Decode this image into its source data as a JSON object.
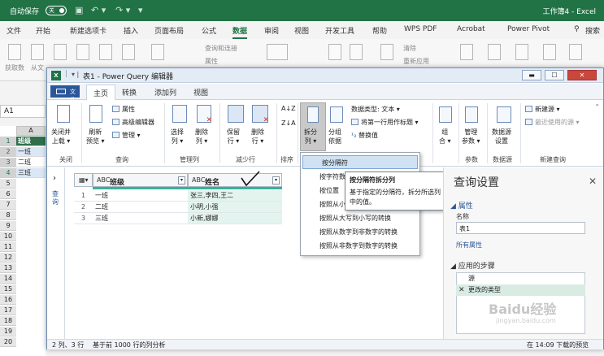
{
  "excel": {
    "autosave_label": "自动保存",
    "toggle_state": "关",
    "workbook_title": "工作簿4 - Excel",
    "tabs": [
      "文件",
      "开始",
      "新建选项卡",
      "插入",
      "页面布局",
      "公式",
      "数据",
      "审阅",
      "视图",
      "开发工具",
      "帮助",
      "WPS PDF",
      "Acrobat",
      "Power Pivot"
    ],
    "active_tab": "数据",
    "search_label": "搜索",
    "ribbon_visible": [
      "获取数",
      "从文",
      "查询和连接",
      "属性",
      "清除",
      "重新应用"
    ],
    "name_box": "A1",
    "col_header": "A",
    "rows": [
      "1",
      "2",
      "3",
      "4",
      "5",
      "6",
      "7",
      "8",
      "9",
      "10",
      "11",
      "12",
      "13",
      "14",
      "15",
      "16",
      "17",
      "18",
      "19",
      "20"
    ],
    "cells": [
      "班级",
      "一班",
      "二班",
      "三班"
    ]
  },
  "pq": {
    "title": "表1 - Power Query 编辑器",
    "file_tab": "文件",
    "tabs": [
      "主页",
      "转换",
      "添加列",
      "视图"
    ],
    "active_tab": "主页",
    "ribbon": {
      "close_load": "关闭并\n上载 ▾",
      "refresh_preview": "刷新\n预览 ▾",
      "properties": "属性",
      "advanced_editor": "高级编辑器",
      "manage": "管理 ▾",
      "choose_cols": "选择\n列 ▾",
      "remove_cols": "删除\n列 ▾",
      "keep_rows": "保留\n行 ▾",
      "remove_rows": "删除\n行 ▾",
      "split_col": "拆分\n列 ▾",
      "group_by": "分组\n依据",
      "data_type": "数据类型: 文本 ▾",
      "first_row_header": "将第一行用作标题 ▾",
      "replace_values": "替换值",
      "combine": "组\n合 ▾",
      "manage_params": "管理\n参数 ▾",
      "data_source_settings": "数据源\n设置",
      "new_source": "新建源 ▾",
      "recent_sources": "最近使用的源 ▾",
      "groups": [
        "关闭",
        "查询",
        "管理列",
        "减少行",
        "排序",
        "参数",
        "数据源",
        "新建查询"
      ]
    },
    "query_pane_label": "查询",
    "columns": [
      {
        "type": "ABC",
        "name": "班级"
      },
      {
        "type": "ABC",
        "name": "姓名"
      }
    ],
    "rows": [
      {
        "n": "1",
        "c1": "一班",
        "c2": "张三,李四,王二"
      },
      {
        "n": "2",
        "c1": "二班",
        "c2": "小明,小强"
      },
      {
        "n": "3",
        "c1": "三班",
        "c2": "小新,娜娜"
      }
    ],
    "split_menu": [
      "按分隔符",
      "按字符数",
      "按位置",
      "按照从小",
      "按照从大写到小写的转换",
      "按照从数字到非数字的转换",
      "按照从非数字到数字的转换"
    ],
    "tooltip": {
      "title": "按分隔符拆分列",
      "body": "基于指定的分隔符，拆分所选列中的值。"
    },
    "settings": {
      "title": "查询设置",
      "properties": "属性",
      "name_label": "名称",
      "name_value": "表1",
      "all_props": "所有属性",
      "applied_steps": "应用的步骤",
      "steps": [
        "源",
        "更改的类型"
      ]
    },
    "status": {
      "left": "2 列、3 行",
      "mid": "基于前 1000 行的列分析",
      "right": "在 14:09 下载的预览"
    }
  },
  "watermark": "Baidu经验",
  "watermark_url": "jingyan.baidu.com"
}
